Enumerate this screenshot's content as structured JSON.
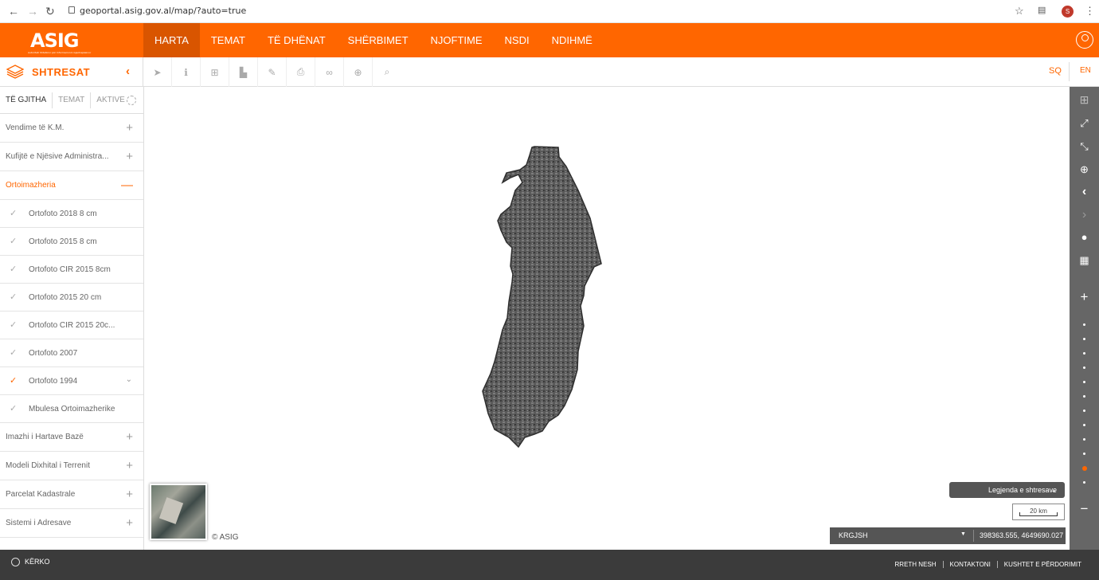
{
  "browser": {
    "url": "geoportal.asig.gov.al/map/?auto=true",
    "profile_initial": "S"
  },
  "header": {
    "logo": "ASIG",
    "logo_subtitle": "Autoriteti Shtetëror për Informacionin Gjeohapësinor",
    "menu": [
      "HARTA",
      "TEMAT",
      "TË DHËNAT",
      "SHËRBIMET",
      "NJOFTIME",
      "NSDI",
      "NDIHMË"
    ],
    "active_menu": "HARTA"
  },
  "toolbar": {
    "layers_title": "SHTRESAT",
    "tool_icons": [
      "select-icon",
      "info-icon",
      "add-icon",
      "chart-icon",
      "edit-icon",
      "print-icon",
      "link-icon",
      "locate-icon",
      "search-icon"
    ],
    "lang_sq": "SQ",
    "lang_en": "EN"
  },
  "sidebar": {
    "tabs": [
      "TË GJITHA",
      "TEMAT",
      "AKTIVE"
    ],
    "groups_top": [
      {
        "label": "Vendime të K.M.",
        "sign": "+"
      },
      {
        "label": "Kufijtë e Njësive Administra...",
        "sign": "+"
      }
    ],
    "open_group": {
      "label": "Ortoimazheria",
      "sign": "—"
    },
    "sub_items": [
      {
        "label": "Ortofoto 2018 8 cm",
        "active": false
      },
      {
        "label": "Ortofoto 2015 8 cm",
        "active": false
      },
      {
        "label": "Ortofoto CIR 2015 8cm",
        "active": false
      },
      {
        "label": "Ortofoto 2015 20 cm",
        "active": false
      },
      {
        "label": "Ortofoto CIR 2015 20c...",
        "active": false
      },
      {
        "label": "Ortofoto 2007",
        "active": false
      },
      {
        "label": "Ortofoto 1994",
        "active": true
      },
      {
        "label": "Mbulesa Ortoimazherike",
        "active": false
      }
    ],
    "groups_bottom": [
      {
        "label": "Imazhi i Hartave Bazë",
        "sign": "+"
      },
      {
        "label": "Modeli Dixhital i Terrenit",
        "sign": "+"
      },
      {
        "label": "Parcelat Kadastrale",
        "sign": "+"
      },
      {
        "label": "Sistemi i Adresave",
        "sign": "+"
      }
    ]
  },
  "map": {
    "copyright": "© ASIG",
    "legend_button": "Legjenda e shtresave",
    "scale": "20 km",
    "crs": "KRGJSH",
    "coordinates": "398363.555, 4649690.027"
  },
  "footer": {
    "search": "KËRKO",
    "links": [
      "RRETH NESH",
      "KONTAKTONI",
      "KUSHTET E PËRDORIMIT"
    ]
  },
  "colors": {
    "accent": "#ff6600",
    "dark": "#3b3b3b",
    "sidebar_right": "#666666"
  }
}
